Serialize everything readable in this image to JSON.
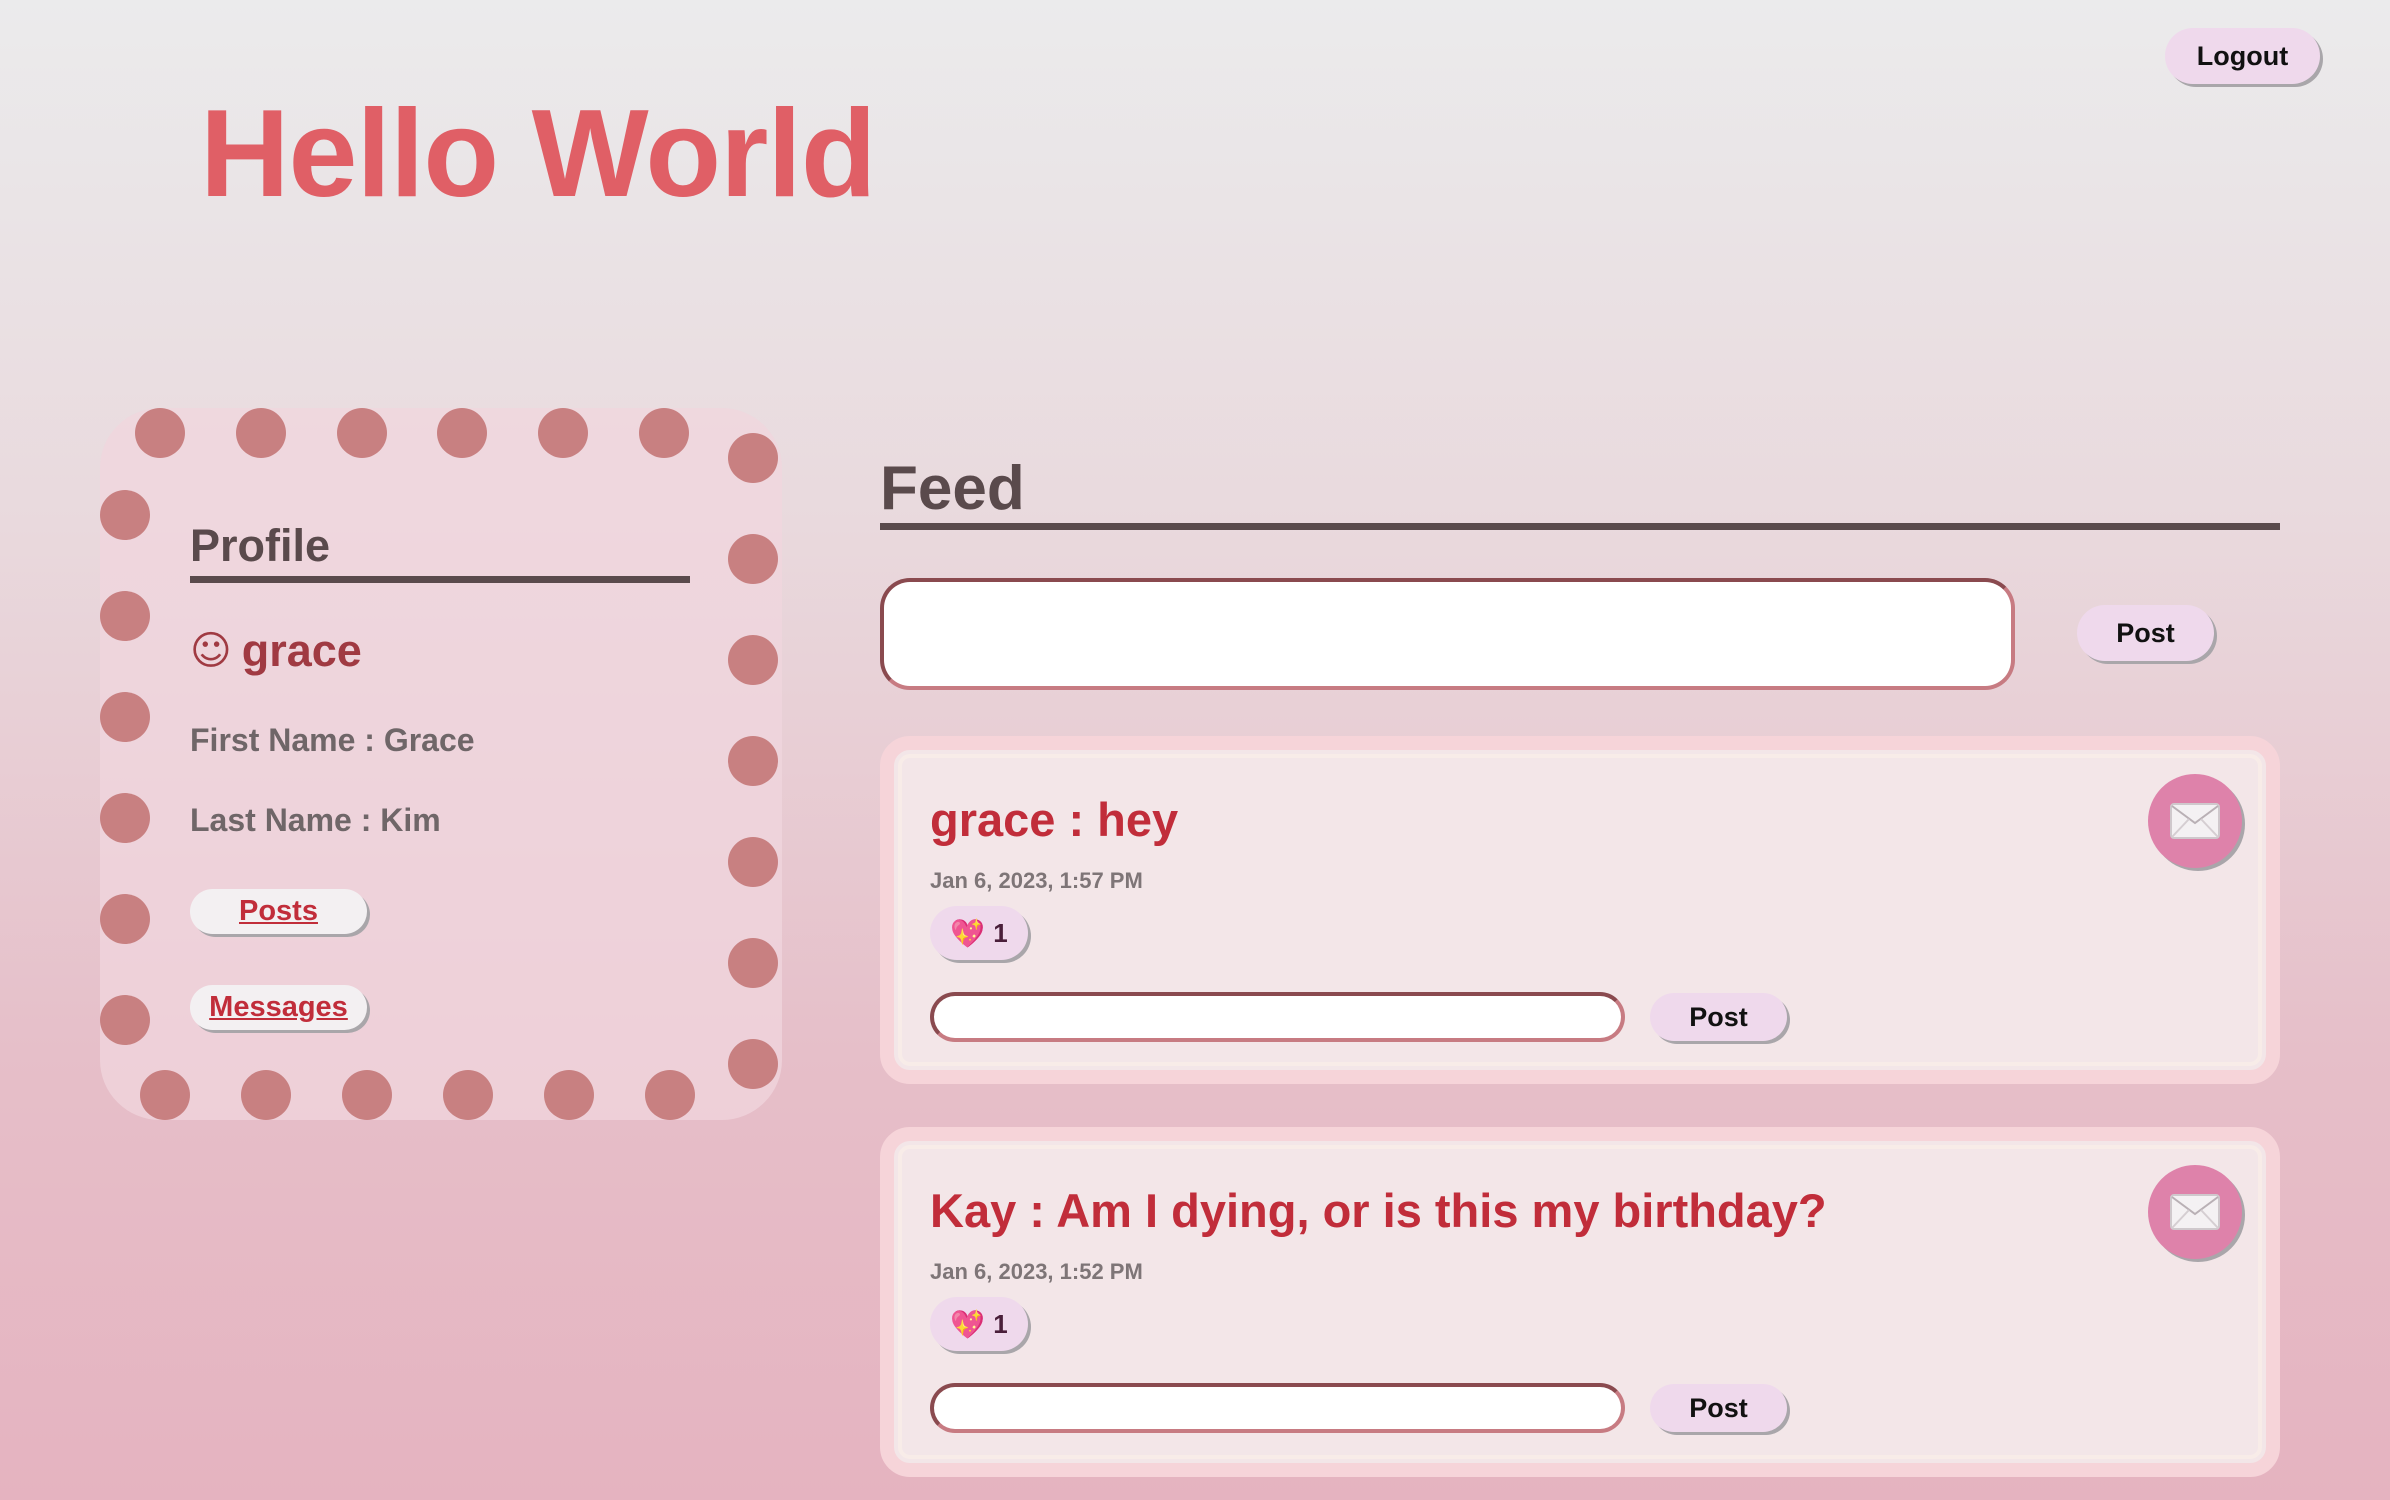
{
  "header": {
    "title": "Hello World",
    "logout_label": "Logout"
  },
  "profile": {
    "heading": "Profile",
    "smile_glyph": "☺",
    "username": "grace",
    "first_name": "First Name : Grace",
    "last_name": "Last Name : Kim",
    "posts_link": "Posts",
    "messages_link": "Messages"
  },
  "feed": {
    "heading": "Feed",
    "new_post": {
      "value": "",
      "post_label": "Post"
    },
    "posts": [
      {
        "title": "grace : hey",
        "date": "Jan 6, 2023, 1:57 PM",
        "likes": "1",
        "heart_icon": "sparkling-heart-icon",
        "comment_value": "",
        "comment_button": "Post",
        "mail_icon": "envelope-icon"
      },
      {
        "title": "Kay : Am I dying, or is this my birthday?",
        "date": "Jan 6, 2023, 1:52 PM",
        "likes": "1",
        "heart_icon": "sparkling-heart-icon",
        "comment_value": "",
        "comment_button": "Post",
        "mail_icon": "envelope-icon"
      }
    ]
  },
  "colors": {
    "title": "#e05f66",
    "accent": "#c12d3a",
    "button_bg": "#efd9ec",
    "dot": "#c88081",
    "mail": "#de82aa"
  }
}
